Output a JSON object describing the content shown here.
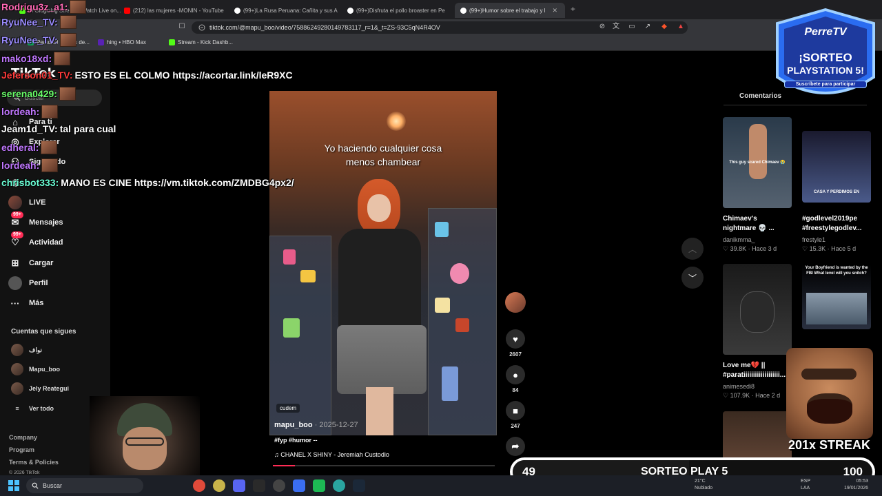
{
  "browser": {
    "tabs": [
      {
        "label": "El Gloglokig Stream - Watch Live on...",
        "color": "#53fc18"
      },
      {
        "label": "(212) las mujeres -MONIN - YouTube",
        "color": "#ff0000"
      },
      {
        "label": "(99+)La Rusa Peruana: Cañita y sus A",
        "color": "#ffffff"
      },
      {
        "label": "(99+)Disfruta el pollo broaster en Pe",
        "color": "#ffffff"
      },
      {
        "label": "(99+)Humor sobre el trabajo y l",
        "color": "#ffffff"
      }
    ],
    "url": "tiktok.com/@mapu_boo/video/75886249280149783117_r=1&_t=ZS-93C5qN4R4OV",
    "bookmarks": [
      {
        "label": "Personal - Hojas de...",
        "color": "#0f9d58"
      },
      {
        "label": "hing • HBO Max",
        "color": "#5822b4"
      },
      {
        "label": "Stream - Kick Dashb...",
        "color": "#53fc18"
      }
    ]
  },
  "tiktok": {
    "logo": "TikTok",
    "search_placeholder": "Buscar",
    "nav": [
      {
        "label": "Para ti",
        "icon": "home-icon"
      },
      {
        "label": "Explorar",
        "icon": "compass-icon"
      },
      {
        "label": "Siguiendo",
        "icon": "following-icon"
      },
      {
        "label": "",
        "icon": "friends-icon"
      },
      {
        "label": "LIVE",
        "icon": "live-icon"
      },
      {
        "label": "Mensajes",
        "icon": "messages-icon",
        "badge": "99+"
      },
      {
        "label": "Actividad",
        "icon": "activity-icon",
        "badge": "99+"
      },
      {
        "label": "Cargar",
        "icon": "upload-icon"
      },
      {
        "label": "Perfil",
        "icon": "profile-icon"
      },
      {
        "label": "Más",
        "icon": "more-icon"
      }
    ],
    "following_title": "Cuentas que sigues",
    "following": [
      "نواف",
      "Mapu_boo",
      "Jely Reategui"
    ],
    "see_all": "Ver todo",
    "footer": [
      "Company",
      "Program",
      "Terms & Policies",
      "© 2026 TikTok"
    ],
    "video": {
      "caption_line1": "Yo haciendo cualquier cosa",
      "caption_line2": "menos chambear",
      "capcut_tag": "cudem",
      "author": "mapu_boo",
      "date": "· 2025-12-27",
      "tags": "#fyp #humor --",
      "music": "CHANEL X SHINY - Jeremiah Custodio",
      "progress": 0.1
    },
    "actions": {
      "likes": "2607",
      "comments": "84",
      "saves": "247",
      "shares": "Compartir"
    },
    "comments_tab": "Comentarios",
    "recommended": [
      {
        "title1": "Chimaev's",
        "title2": "nightmare 💀 ...",
        "author": "danikmma_",
        "likes": "39.8K",
        "time": "Hace 3 d",
        "overlay": "This guy scared Chimaev 😭"
      },
      {
        "title1": "#godlevel2019pe",
        "title2": "#freestylegodlev...",
        "author": "frestyle1",
        "likes": "15.3K",
        "time": "Hace 5 d",
        "overlay": "CASA Y PERDIMOS EN"
      },
      {
        "title1": "Love me💔 ||",
        "title2": "#paratiiiiiiiiiiiiiiiiiii...",
        "author": "animesedi8",
        "likes": "107.9K",
        "time": "Hace 2 d",
        "overlay": ""
      },
      {
        "title1": "",
        "title2": "",
        "author": "",
        "likes": "",
        "time": "",
        "overlay": "Your Boyfriend is wanted by the FBI What level will you snitch?"
      }
    ]
  },
  "chat": [
    {
      "user": "Rodrigu3z_a1:",
      "text": "",
      "color": "#ff69b4",
      "emote": true
    },
    {
      "user": "RyuNee_TV:",
      "text": "",
      "color": "#9b8cff",
      "emote": true
    },
    {
      "user": "RyuNee_TV:",
      "text": "",
      "color": "#9b8cff",
      "emote": true
    },
    {
      "user": "mako18xd:",
      "text": "",
      "color": "#c178ff",
      "emote": true
    },
    {
      "user": "Jeferson01_TV:",
      "text": "ESTO ES EL COLMO https://acortar.link/leR9XC",
      "color": "#ff3b3b",
      "emote": false
    },
    {
      "user": "serena0429:",
      "text": "",
      "color": "#6bff6b",
      "emote": true
    },
    {
      "user": "lordeah:",
      "text": "",
      "color": "#c178ff",
      "emote": true
    },
    {
      "user": "Jeam1d_TV:",
      "text": "tal para cual",
      "color": "#ffffff",
      "emote": false
    },
    {
      "user": "edheral:",
      "text": "",
      "color": "#c178ff",
      "emote": true
    },
    {
      "user": "lordeah:",
      "text": "",
      "color": "#c178ff",
      "emote": true
    },
    {
      "user": "chrisbot333:",
      "text": "MANO ES CINE https://vm.tiktok.com/ZMDBG4px2/",
      "color": "#6bffd6",
      "emote": false
    }
  ],
  "overlay": {
    "promo_brand": "PerreTV",
    "promo_line1": "¡SORTEO",
    "promo_line2": "PLAYSTATION 5!",
    "promo_sub": "Suscríbete para participar",
    "streak": "201x STREAK",
    "sorteo_current": "49",
    "sorteo_label": "SORTEO PLAY 5",
    "sorteo_goal": "100",
    "sorteo_progress": 0.49
  },
  "taskbar": {
    "search": "Buscar",
    "weather": "21°C",
    "weather_desc": "Nublado",
    "lang": "ESP",
    "lang2": "LAA",
    "time": "05:53",
    "date": "19/01/2026"
  },
  "colors": {
    "accent": "#fe2c55",
    "bg": "#000000",
    "sidebar": "#121212"
  }
}
